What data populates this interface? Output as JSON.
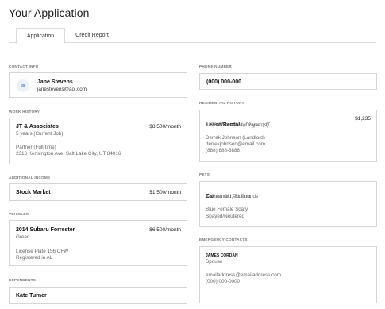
{
  "page": {
    "title": "Your Application"
  },
  "tabs": [
    {
      "label": "Application",
      "active": true
    },
    {
      "label": "Credit Report",
      "active": false
    }
  ],
  "contact_info": {
    "label": "CONTACT INFO",
    "initials": "JS",
    "name": "Jane Stevens",
    "email": "janestevens@aol.com"
  },
  "phone_number": {
    "label": "PHONE NUMBER",
    "value": "(000) 000-000"
  },
  "work_history": {
    "label": "WORK HISTORY",
    "employer": "JT & Associates",
    "amount": "$8,500/month",
    "tenure": "5 years (Current Job)",
    "role": "Partner (Full-time)",
    "address": "2316 Kensington Ave. Salt Lake City, UT 84016"
  },
  "residential_history": {
    "label": "RESIDENTIAL HISTORY",
    "type": "Lease/Rental",
    "duration": " for 2 year(s)",
    "amount": "$1,235",
    "address": "3378 S Park Ave, Draper, UT",
    "contact_name": "Derrek Johnson (Landlord)",
    "contact_email": "derrekjohnson@email.com",
    "contact_phone": "(888) 888-8888"
  },
  "additional_income": {
    "label": "ADDITIONAL INCOME",
    "source": "Stock Market",
    "amount": "$1,500/month"
  },
  "pets": {
    "label": "PETS",
    "type": "Cat",
    "name_text": " named Phoenix",
    "age_weight": "3 Years Old, 21 Pounds",
    "description": "Blue Female Scary",
    "status": "Spayed/Neutered"
  },
  "vehicles": {
    "label": "VEHICLES",
    "vehicle": "2014 Subaru Forrester",
    "amount": "$6,500/month",
    "color": "Green",
    "plate": "License Plate 156 CFW",
    "registered": "Registered in AL"
  },
  "emergency_contacts": {
    "label": "EMERGENCY CONTACTS",
    "name": "JAMES CORDAN",
    "relation": "Spouse",
    "email": "emailaddress@emailaddress.com",
    "phone": "(000) 000-0000"
  },
  "dependents": {
    "label": "DEPENDENTS",
    "name": "Kate Turner"
  },
  "colors": {
    "accent_blue": "#3a6fc4",
    "border": "#d5d5d5",
    "label_gray": "#777777"
  }
}
